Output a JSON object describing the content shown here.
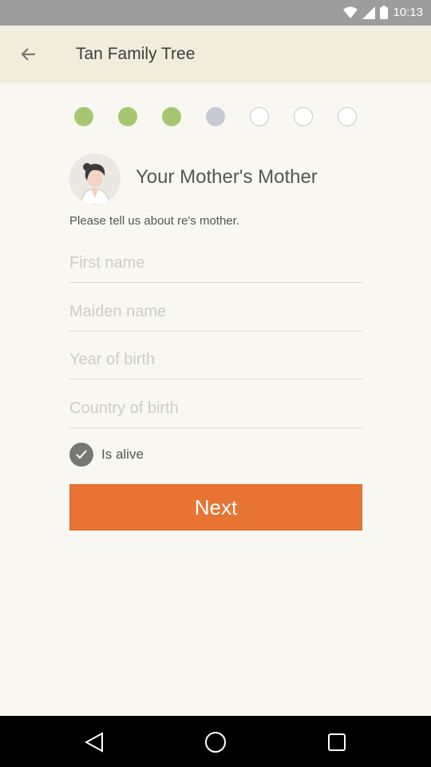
{
  "status_bar": {
    "time": "10:13"
  },
  "app_bar": {
    "title": "Tan Family Tree",
    "back_icon": "arrow-left-icon"
  },
  "progress": {
    "total_steps": 7,
    "completed_steps": 3,
    "current_step": 4
  },
  "form": {
    "avatar_icon": "grandmother-avatar",
    "title": "Your Mother's Mother",
    "subtitle": "Please tell us about re's mother.",
    "first_name": {
      "value": "",
      "placeholder": "First name"
    },
    "maiden_name": {
      "value": "",
      "placeholder": "Maiden name"
    },
    "year_of_birth": {
      "value": "",
      "placeholder": "Year of birth"
    },
    "country_of_birth": {
      "value": "",
      "placeholder": "Country of birth"
    },
    "is_alive": {
      "label": "Is alive",
      "checked": true
    },
    "next_label": "Next"
  },
  "nav_bar": {
    "back_icon": "triangle-back-icon",
    "home_icon": "circle-home-icon",
    "recents_icon": "square-recents-icon"
  },
  "colors": {
    "accent": "#e77433",
    "step_done": "#a5c772",
    "step_current": "#c8c8d4",
    "app_bar": "#f1eddd",
    "status_bar": "#9d9d9d"
  }
}
